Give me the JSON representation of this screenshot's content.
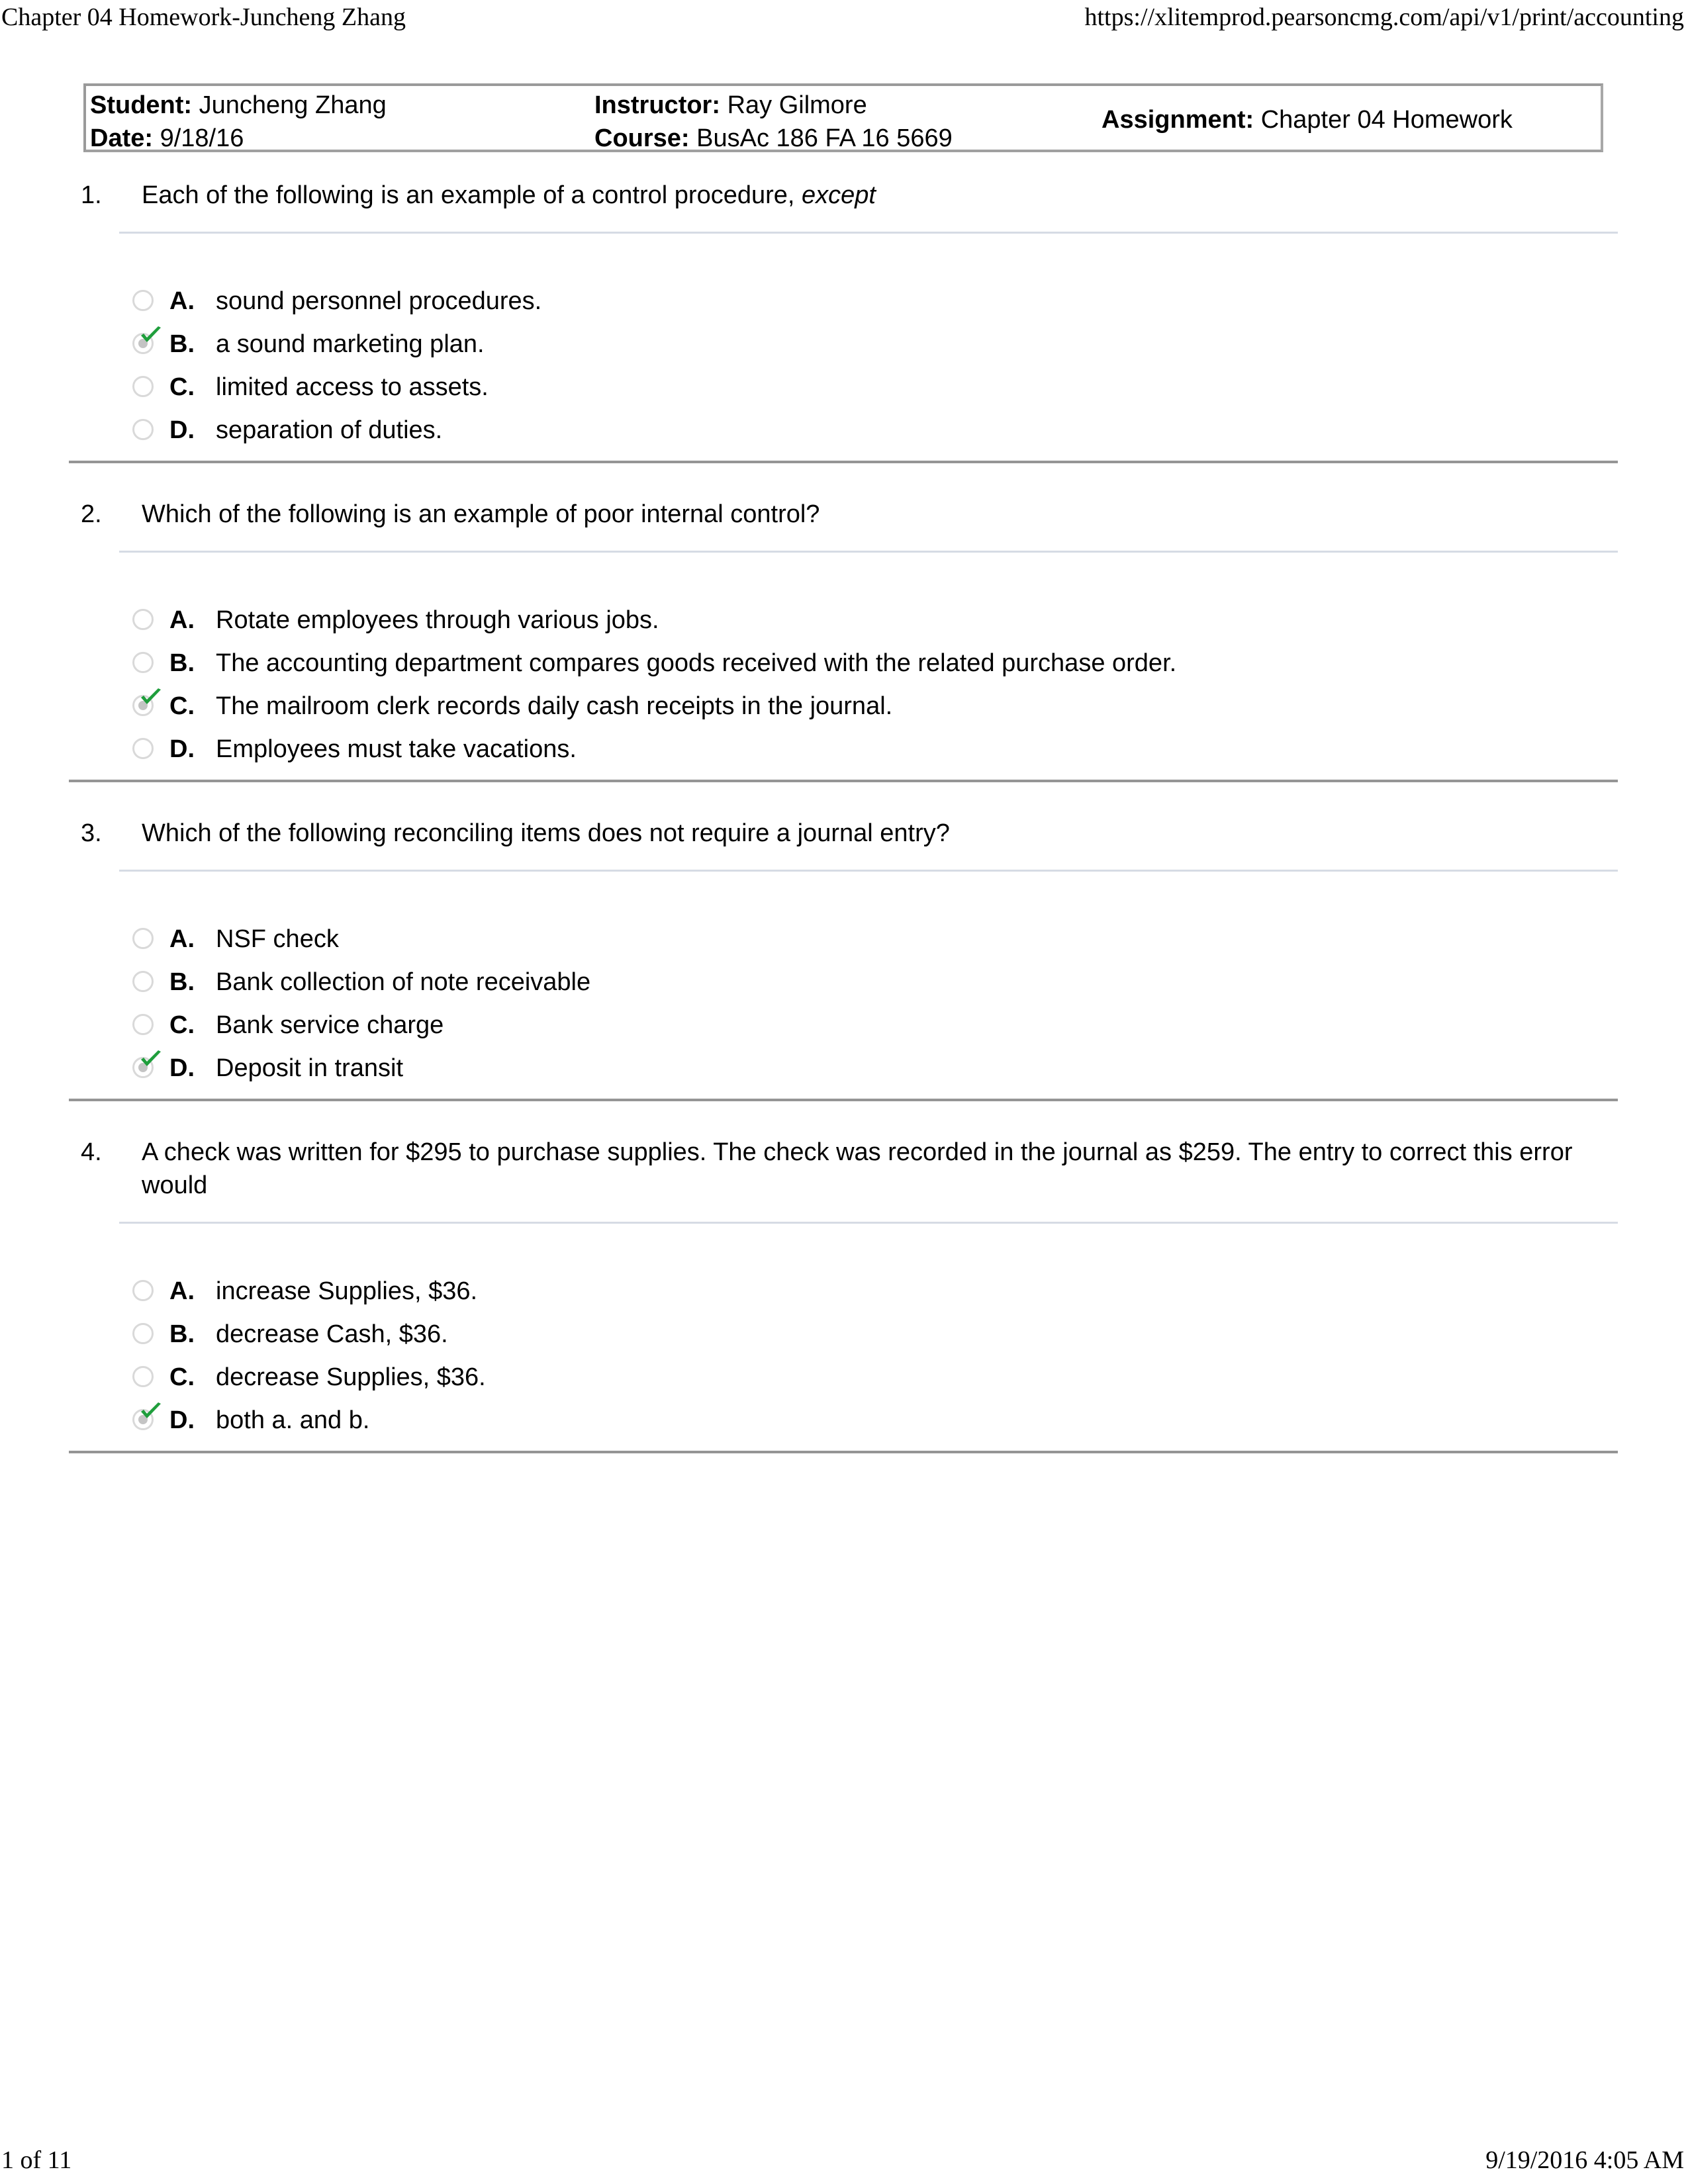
{
  "print_header": {
    "title": "Chapter 04 Homework-Juncheng Zhang",
    "url": "https://xlitemprod.pearsoncmg.com/api/v1/print/accounting"
  },
  "print_footer": {
    "page": "1 of 11",
    "timestamp": "9/19/2016 4:05 AM"
  },
  "info": {
    "student_label": "Student:",
    "student": "Juncheng Zhang",
    "date_label": "Date:",
    "date": "9/18/16",
    "instructor_label": "Instructor:",
    "instructor": "Ray Gilmore",
    "course_label": "Course:",
    "course": "BusAc 186 FA 16 5669",
    "assignment_label": "Assignment:",
    "assignment": "Chapter 04 Homework"
  },
  "colors": {
    "check_green": "#1f9e3c",
    "radio_border": "#d9d9d9",
    "separator": "#d6dbe4",
    "question_divider": "#959595"
  },
  "questions": [
    {
      "number": "1.",
      "text": "Each of the following is an example of a control procedure, ",
      "text_italic": "except",
      "selected": "B",
      "options": [
        {
          "letter": "A.",
          "text": "sound personnel procedures."
        },
        {
          "letter": "B.",
          "text": "a sound marketing plan."
        },
        {
          "letter": "C.",
          "text": "limited access to assets."
        },
        {
          "letter": "D.",
          "text": "separation of duties."
        }
      ]
    },
    {
      "number": "2.",
      "text": "Which of the following is an example of poor internal control?",
      "selected": "C",
      "options": [
        {
          "letter": "A.",
          "text": "Rotate employees through various jobs."
        },
        {
          "letter": "B.",
          "text": "The accounting department compares goods received with the related purchase order."
        },
        {
          "letter": "C.",
          "text": "The mailroom clerk records daily cash receipts in the journal."
        },
        {
          "letter": "D.",
          "text": "Employees must take vacations."
        }
      ]
    },
    {
      "number": "3.",
      "text": "Which of the following reconciling items does not require a journal entry?",
      "selected": "D",
      "options": [
        {
          "letter": "A.",
          "text": "NSF check"
        },
        {
          "letter": "B.",
          "text": "Bank collection of note receivable"
        },
        {
          "letter": "C.",
          "text": "Bank service charge"
        },
        {
          "letter": "D.",
          "text": "Deposit in transit"
        }
      ]
    },
    {
      "number": "4.",
      "text": "A check was written for $295 to purchase supplies. The check was recorded in the journal as $259. The entry to correct this error would",
      "selected": "D",
      "options": [
        {
          "letter": "A.",
          "text": "increase Supplies, $36."
        },
        {
          "letter": "B.",
          "text": "decrease Cash, $36."
        },
        {
          "letter": "C.",
          "text": "decrease Supplies, $36."
        },
        {
          "letter": "D.",
          "text": "both a. and b."
        }
      ]
    }
  ]
}
